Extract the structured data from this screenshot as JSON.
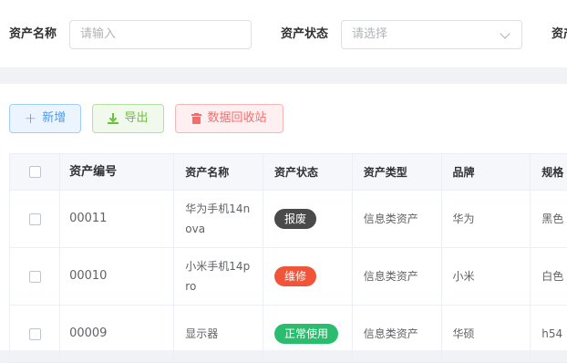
{
  "filters": {
    "name_label": "资产名称",
    "name_placeholder": "请输入",
    "status_label": "资产状态",
    "status_placeholder": "请选择",
    "type_label_partial": "资产"
  },
  "toolbar": {
    "add_label": "新增",
    "export_label": "导出",
    "recycle_label": "数据回收站"
  },
  "table": {
    "columns": [
      "资产编号",
      "资产名称",
      "资产状态",
      "资产类型",
      "品牌",
      "规格"
    ],
    "rows": [
      {
        "no": "00011",
        "name": "华为手机14nova",
        "status": "报废",
        "status_color": "#4a4a4a",
        "type": "信息类资产",
        "brand": "华为",
        "spec": "黑色"
      },
      {
        "no": "00010",
        "name": "小米手机14pro",
        "status": "维修",
        "status_color": "#f0553a",
        "type": "信息类资产",
        "brand": "小米",
        "spec": "白色"
      },
      {
        "no": "00009",
        "name": "显示器",
        "status": "正常使用",
        "status_color": "#2bbd6e",
        "type": "信息类资产",
        "brand": "华硕",
        "spec": "h54"
      }
    ]
  },
  "colors": {
    "primary": "#409eff",
    "success": "#67c23a",
    "danger": "#f56c6c"
  }
}
